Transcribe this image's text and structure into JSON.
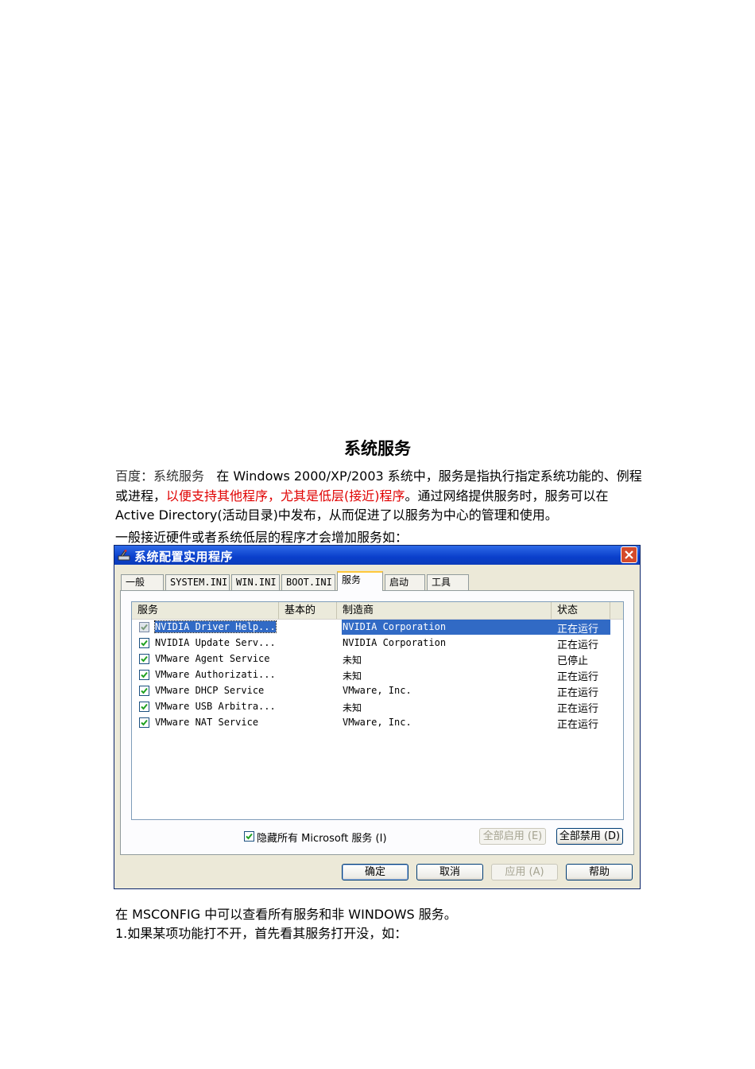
{
  "document": {
    "title": "系统服务",
    "intro_source": "百度：系统服务",
    "intro_part1": "在 Windows 2000/XP/2003 系统中，服务是指执行指定系统功能的、例程或进程，",
    "intro_highlight": "以便支持其他程序，尤其是低层(接近)程序",
    "intro_part2": "。通过网络提供服务时，服务可以在 Active Directory(活动目录)中发布，从而促进了以服务为中心的管理和使用。",
    "line_before_dialog": "一般接近硬件或者系统低层的程序才会增加服务如：",
    "line_after_1": "在 MSCONFIG 中可以查看所有服务和非 WINDOWS 服务。",
    "line_after_2": "1.如果某项功能打不开，首先看其服务打开没，如："
  },
  "dialog": {
    "title": "系统配置实用程序",
    "tabs": [
      "一般",
      "SYSTEM.INI",
      "WIN.INI",
      "BOOT.INI",
      "服务",
      "启动",
      "工具"
    ],
    "active_tab": "服务",
    "columns": [
      "服务",
      "基本的",
      "制造商",
      "状态"
    ],
    "rows": [
      {
        "name": "NVIDIA Driver Help...",
        "essential": "",
        "maker": "NVIDIA Corporation",
        "status": "正在运行",
        "checked": true,
        "selected": true
      },
      {
        "name": "NVIDIA Update Serv...",
        "essential": "",
        "maker": "NVIDIA Corporation",
        "status": "正在运行",
        "checked": true,
        "selected": false
      },
      {
        "name": "VMware Agent Service",
        "essential": "",
        "maker": "未知",
        "status": "已停止",
        "checked": true,
        "selected": false
      },
      {
        "name": "VMware Authorizati...",
        "essential": "",
        "maker": "未知",
        "status": "正在运行",
        "checked": true,
        "selected": false
      },
      {
        "name": "VMware DHCP Service",
        "essential": "",
        "maker": "VMware, Inc.",
        "status": "正在运行",
        "checked": true,
        "selected": false
      },
      {
        "name": "VMware USB Arbitra...",
        "essential": "",
        "maker": "未知",
        "status": "正在运行",
        "checked": true,
        "selected": false
      },
      {
        "name": "VMware NAT Service",
        "essential": "",
        "maker": "VMware, Inc.",
        "status": "正在运行",
        "checked": true,
        "selected": false
      }
    ],
    "hide_ms_label": "隐藏所有 Microsoft 服务 (I)",
    "hide_ms_checked": true,
    "enable_all": "全部启用 (E)",
    "disable_all": "全部禁用 (D)",
    "ok": "确定",
    "cancel": "取消",
    "apply": "应用 (A)",
    "help": "帮助"
  }
}
